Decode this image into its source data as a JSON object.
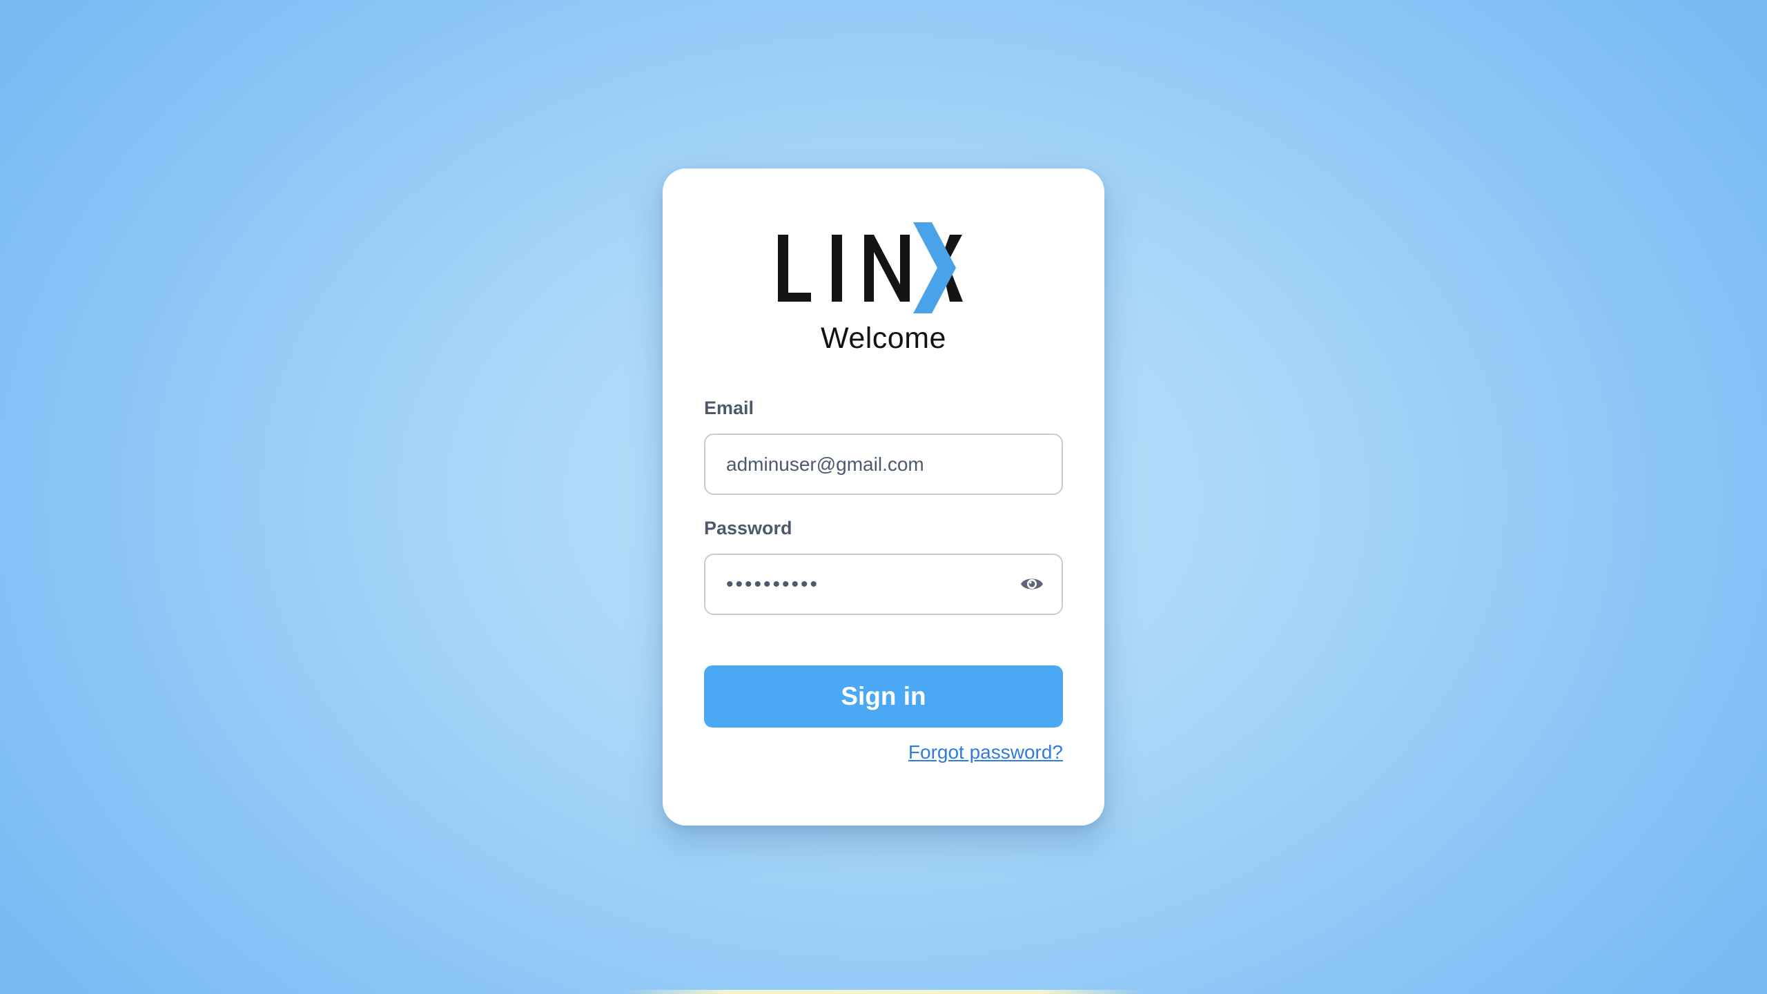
{
  "brand": {
    "logo_text": "LINX",
    "logo_accent_color": "#4aa3e8",
    "logo_text_color": "#141414"
  },
  "welcome": "Welcome",
  "form": {
    "email_label": "Email",
    "email_value": "adminuser@gmail.com",
    "password_label": "Password",
    "password_value": "••••••••••",
    "password_toggle_icon": "eye-icon",
    "signin_label": "Sign in",
    "forgot_label": "Forgot password?"
  },
  "colors": {
    "primary": "#4aa8f5",
    "link": "#2f7be0",
    "label": "#4d5a6e",
    "background": "#a9d6f8"
  }
}
